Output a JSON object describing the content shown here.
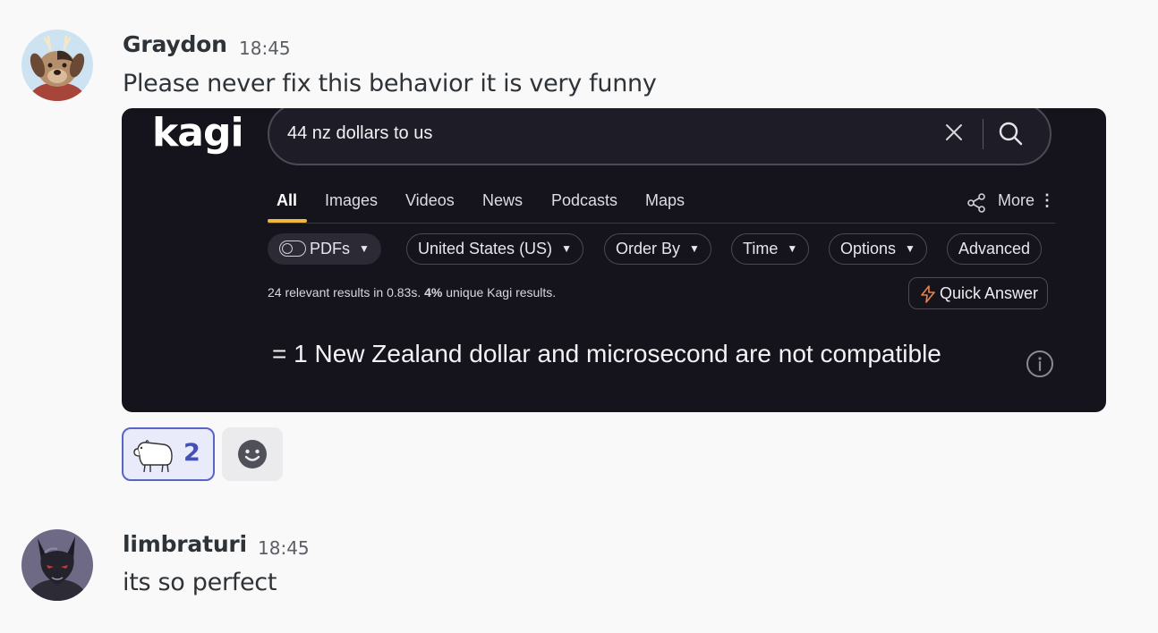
{
  "messages": [
    {
      "author": "Graydon",
      "time": "18:45",
      "text": "Please never fix this behavior it is very funny",
      "avatar_icon": "dog-avatar",
      "attachment": {
        "logo": "kagi",
        "search": {
          "query": "44 nz dollars to us"
        },
        "tabs": [
          "All",
          "Images",
          "Videos",
          "News",
          "Podcasts",
          "Maps"
        ],
        "more_label": "More",
        "filters": [
          {
            "label": "PDFs",
            "has_toggle": true
          },
          {
            "label": "United States (US)"
          },
          {
            "label": "Order By"
          },
          {
            "label": "Time"
          },
          {
            "label": "Options"
          },
          {
            "label": "Advanced"
          }
        ],
        "stats_prefix": "24 relevant results in 0.83s. ",
        "stats_bold": "4%",
        "stats_suffix": " unique Kagi results.",
        "quick_answer_label": "Quick Answer",
        "answer": "= 1 New Zealand dollar and microsecond are not compatible"
      },
      "reactions": [
        {
          "emoji": "capybara",
          "count": "2",
          "selected": true
        }
      ]
    },
    {
      "author": "limbraturi",
      "time": "18:45",
      "text": "its so perfect",
      "avatar_icon": "wolf-avatar"
    }
  ],
  "colors": {
    "accent": "#5865c5",
    "kagi_accent": "#f1b83e",
    "background": "#f9f9fa"
  }
}
